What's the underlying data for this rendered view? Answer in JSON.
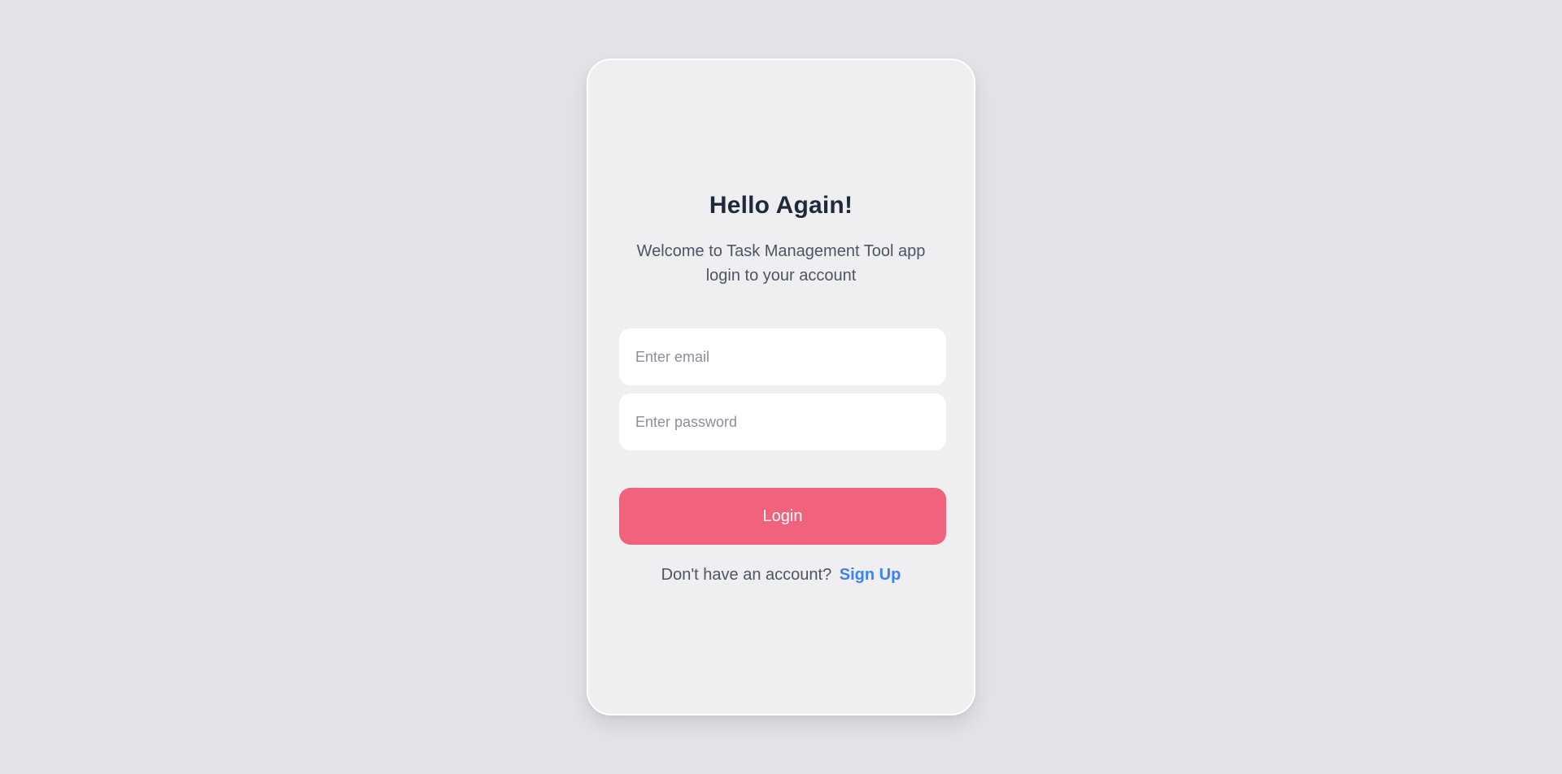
{
  "card": {
    "title": "Hello Again!",
    "subtitle_line1": "Welcome to Task Management Tool app",
    "subtitle_line2": "login to your account"
  },
  "form": {
    "email_placeholder": "Enter email",
    "email_value": "",
    "password_placeholder": "Enter password",
    "password_value": "",
    "login_label": "Login"
  },
  "footer": {
    "prompt": "Don't have an account?",
    "signup_label": "Sign Up"
  },
  "colors": {
    "background": "#e4e4e8",
    "card": "#efeff1",
    "primary_button": "#f1637c",
    "link": "#3b82f6",
    "heading": "#1e293b"
  }
}
